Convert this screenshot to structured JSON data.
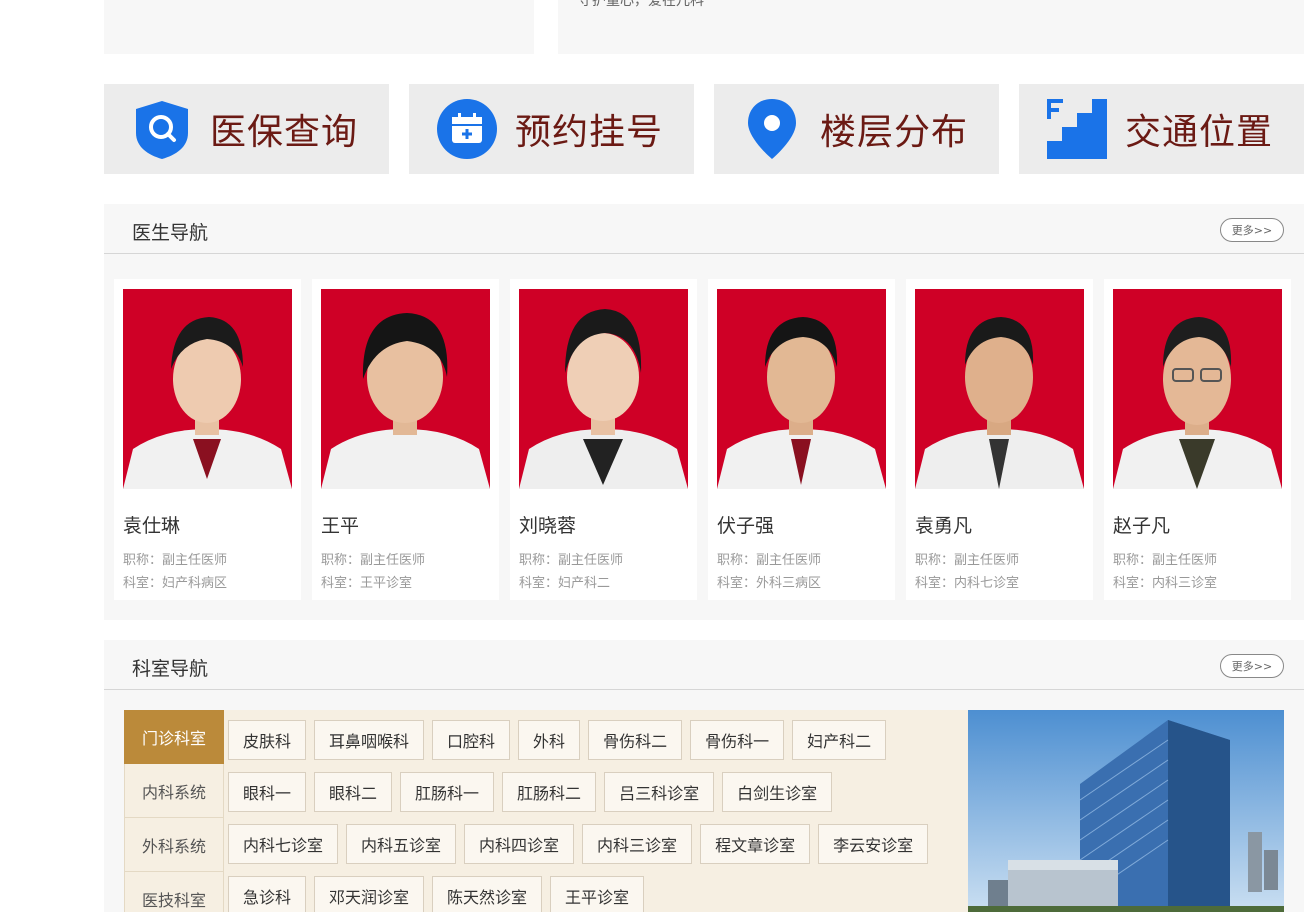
{
  "top": {
    "slogan": "守护童心，爱在儿科"
  },
  "quick_links": [
    {
      "label": "医保查询",
      "icon": "shield-search-icon"
    },
    {
      "label": "预约挂号",
      "icon": "calendar-plus-icon"
    },
    {
      "label": "楼层分布",
      "icon": "map-pin-icon"
    },
    {
      "label": "交通位置",
      "icon": "floor-stairs-icon"
    }
  ],
  "doctors_section": {
    "title": "医生导航",
    "more": "更多>>",
    "doctors": [
      {
        "name": "袁仕琳",
        "title": "职称：副主任医师",
        "dept": "科室：妇产科病区"
      },
      {
        "name": "王平",
        "title": "职称：副主任医师",
        "dept": "科室：王平诊室"
      },
      {
        "name": "刘晓蓉",
        "title": "职称：副主任医师",
        "dept": "科室：妇产科二"
      },
      {
        "name": "伏子强",
        "title": "职称：副主任医师",
        "dept": "科室：外科三病区"
      },
      {
        "name": "袁勇凡",
        "title": "职称：副主任医师",
        "dept": "科室：内科七诊室"
      },
      {
        "name": "赵子凡",
        "title": "职称：副主任医师",
        "dept": "科室：内科三诊室"
      }
    ]
  },
  "dept_section": {
    "title": "科室导航",
    "more": "更多>>",
    "tabs": [
      "门诊科室",
      "内科系统",
      "外科系统",
      "医技科室"
    ],
    "active_tab": "门诊科室",
    "rows": [
      [
        "皮肤科",
        "耳鼻咽喉科",
        "口腔科",
        "外科",
        "骨伤科二",
        "骨伤科一",
        "妇产科二"
      ],
      [
        "眼科一",
        "眼科二",
        "肛肠科一",
        "肛肠科二",
        "吕三科诊室",
        "白剑生诊室"
      ],
      [
        "内科七诊室",
        "内科五诊室",
        "内科四诊室",
        "内科三诊室",
        "程文章诊室",
        "李云安诊室"
      ],
      [
        "急诊科",
        "邓天润诊室",
        "陈天然诊室",
        "王平诊室"
      ]
    ]
  },
  "colors": {
    "quick_icon_blue": "#1a73e8",
    "quick_label": "#6b1a14",
    "active_tab": "#bb8a3a",
    "photo_bg": "#cf0026"
  }
}
